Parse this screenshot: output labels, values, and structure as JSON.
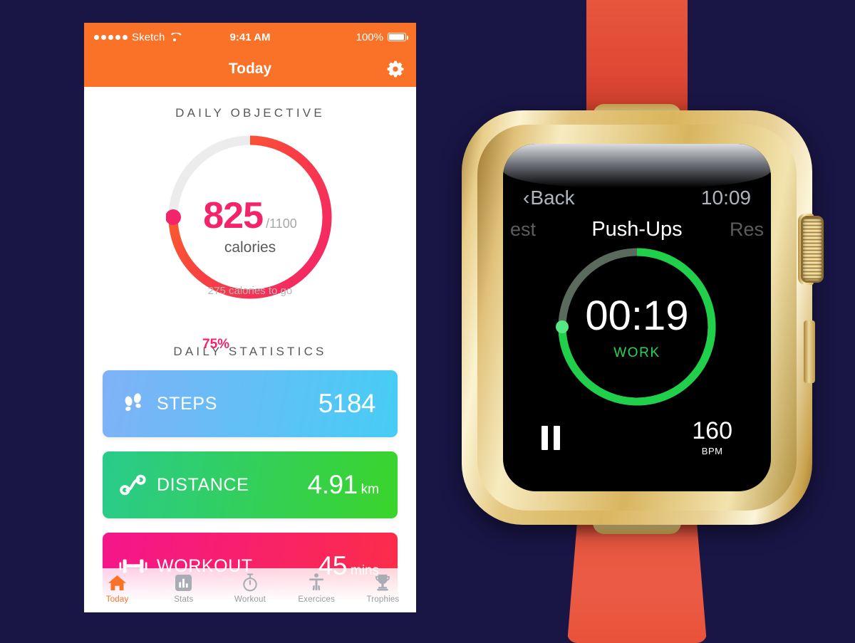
{
  "phone": {
    "status_bar": {
      "signal_dots": 5,
      "carrier": "Sketch",
      "wifi_icon": "wifi-icon",
      "time": "9:41 AM",
      "battery_percent": "100%",
      "battery_icon": "battery-full-icon"
    },
    "nav": {
      "title": "Today",
      "settings_icon": "gear-icon"
    },
    "objective": {
      "section_title": "DAILY OBJECTIVE",
      "percent_label": "75%",
      "value": "825",
      "goal": "/1100",
      "unit": "calories",
      "remaining": "275 calories to go",
      "progress_pct": 75,
      "track_color": "#ECECEC",
      "start_color": "#FA6428",
      "end_color": "#F4246A",
      "dot_color": "#F4246A"
    },
    "statistics": {
      "section_title": "DAILY STATISTICS",
      "cards": [
        {
          "id": "steps",
          "icon": "footsteps-icon",
          "label": "STEPS",
          "value": "5184",
          "unit": "",
          "color_from": "#7FB2F7",
          "color_to": "#46CDF5"
        },
        {
          "id": "distance",
          "icon": "route-icon",
          "label": "DISTANCE",
          "value": "4.91",
          "unit": "km",
          "color_from": "#2ACB8C",
          "color_to": "#3BD42B"
        },
        {
          "id": "workout",
          "icon": "dumbbell-icon",
          "label": "WORKOUT",
          "value": "45",
          "unit": "mins",
          "color_from": "#F5158C",
          "color_to": "#FB2D48"
        }
      ]
    },
    "tabbar": {
      "active_color": "#F97228",
      "inactive_color": "#9A9AA0",
      "tabs": [
        {
          "icon": "home-icon",
          "label": "Today",
          "active": true
        },
        {
          "icon": "bar-chart-icon",
          "label": "Stats",
          "active": false
        },
        {
          "icon": "stopwatch-icon",
          "label": "Workout",
          "active": false
        },
        {
          "icon": "accessibility-icon",
          "label": "Exercices",
          "active": false
        },
        {
          "icon": "trophy-icon",
          "label": "Trophies",
          "active": false
        }
      ]
    }
  },
  "watch": {
    "back_label": "Back",
    "back_chevron": "‹",
    "time": "10:09",
    "carousel": {
      "left": "est",
      "center": "Push-Ups",
      "right": "Res"
    },
    "timer": {
      "value": "00:19",
      "phase": "WORK",
      "progress_pct": 75,
      "ring_color": "#20D04B",
      "track_color": "#5A6A5C",
      "dot_color": "#57E884",
      "phase_color": "#27D552"
    },
    "pause_icon": "pause-icon",
    "heart_rate": {
      "value": "160",
      "unit": "BPM"
    },
    "hardware": {
      "case_color": "#D9B65E",
      "band_color": "#E8563E",
      "crown_icon": "digital-crown"
    }
  },
  "background_color": "#191545"
}
